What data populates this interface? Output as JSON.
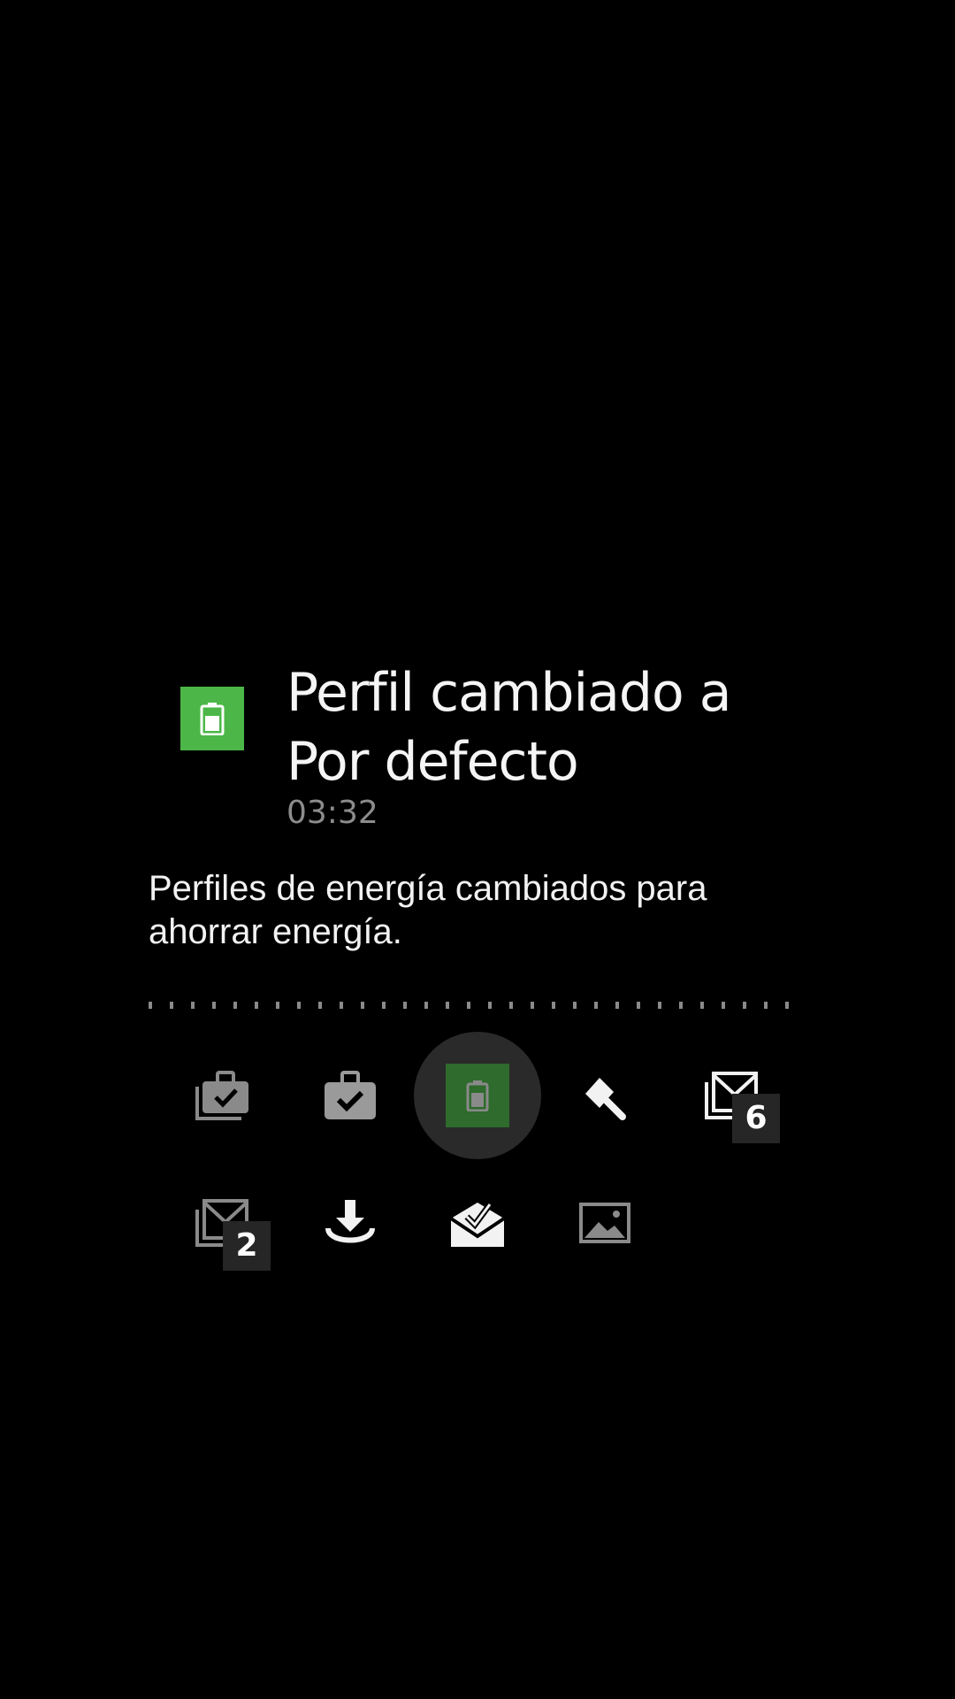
{
  "notification": {
    "title": "Perfil cambiado a Por defecto",
    "time": "03:32",
    "body": "Perfiles de energía cambiados para ahorrar energía.",
    "app_icon": "battery-icon",
    "app_icon_color": "#4CB748"
  },
  "icons_row_1": [
    {
      "icon": "stacked-briefcase-check-icon"
    },
    {
      "icon": "briefcase-check-icon"
    },
    {
      "icon": "battery-icon",
      "selected": true
    },
    {
      "icon": "paint-brush-icon"
    },
    {
      "icon": "stacked-mail-icon",
      "badge": "6"
    }
  ],
  "icons_row_2": [
    {
      "icon": "stacked-mail-icon",
      "badge": "2"
    },
    {
      "icon": "download-icon"
    },
    {
      "icon": "mail-open-check-icon"
    },
    {
      "icon": "image-icon"
    }
  ],
  "badges": {
    "mail_row1": "6",
    "mail_row2": "2"
  },
  "colors": {
    "background": "#000000",
    "accent_green": "#4CB748",
    "selected_green": "#2E6B2C",
    "secondary_text": "#8C8C8C"
  }
}
